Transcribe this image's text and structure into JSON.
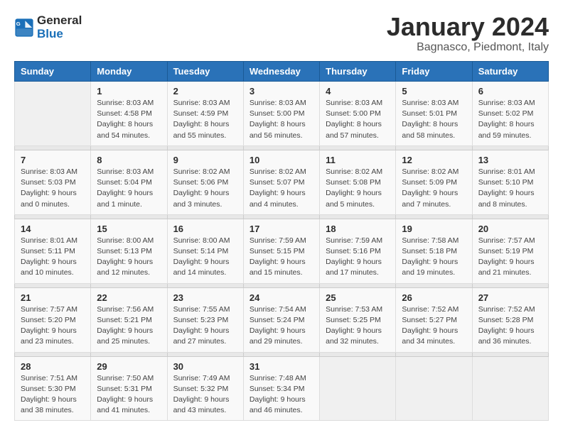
{
  "logo": {
    "line1": "General",
    "line2": "Blue"
  },
  "title": "January 2024",
  "location": "Bagnasco, Piedmont, Italy",
  "days_of_week": [
    "Sunday",
    "Monday",
    "Tuesday",
    "Wednesday",
    "Thursday",
    "Friday",
    "Saturday"
  ],
  "weeks": [
    [
      {
        "day": "",
        "info": ""
      },
      {
        "day": "1",
        "info": "Sunrise: 8:03 AM\nSunset: 4:58 PM\nDaylight: 8 hours\nand 54 minutes."
      },
      {
        "day": "2",
        "info": "Sunrise: 8:03 AM\nSunset: 4:59 PM\nDaylight: 8 hours\nand 55 minutes."
      },
      {
        "day": "3",
        "info": "Sunrise: 8:03 AM\nSunset: 5:00 PM\nDaylight: 8 hours\nand 56 minutes."
      },
      {
        "day": "4",
        "info": "Sunrise: 8:03 AM\nSunset: 5:00 PM\nDaylight: 8 hours\nand 57 minutes."
      },
      {
        "day": "5",
        "info": "Sunrise: 8:03 AM\nSunset: 5:01 PM\nDaylight: 8 hours\nand 58 minutes."
      },
      {
        "day": "6",
        "info": "Sunrise: 8:03 AM\nSunset: 5:02 PM\nDaylight: 8 hours\nand 59 minutes."
      }
    ],
    [
      {
        "day": "7",
        "info": "Sunrise: 8:03 AM\nSunset: 5:03 PM\nDaylight: 9 hours\nand 0 minutes."
      },
      {
        "day": "8",
        "info": "Sunrise: 8:03 AM\nSunset: 5:04 PM\nDaylight: 9 hours\nand 1 minute."
      },
      {
        "day": "9",
        "info": "Sunrise: 8:02 AM\nSunset: 5:06 PM\nDaylight: 9 hours\nand 3 minutes."
      },
      {
        "day": "10",
        "info": "Sunrise: 8:02 AM\nSunset: 5:07 PM\nDaylight: 9 hours\nand 4 minutes."
      },
      {
        "day": "11",
        "info": "Sunrise: 8:02 AM\nSunset: 5:08 PM\nDaylight: 9 hours\nand 5 minutes."
      },
      {
        "day": "12",
        "info": "Sunrise: 8:02 AM\nSunset: 5:09 PM\nDaylight: 9 hours\nand 7 minutes."
      },
      {
        "day": "13",
        "info": "Sunrise: 8:01 AM\nSunset: 5:10 PM\nDaylight: 9 hours\nand 8 minutes."
      }
    ],
    [
      {
        "day": "14",
        "info": "Sunrise: 8:01 AM\nSunset: 5:11 PM\nDaylight: 9 hours\nand 10 minutes."
      },
      {
        "day": "15",
        "info": "Sunrise: 8:00 AM\nSunset: 5:13 PM\nDaylight: 9 hours\nand 12 minutes."
      },
      {
        "day": "16",
        "info": "Sunrise: 8:00 AM\nSunset: 5:14 PM\nDaylight: 9 hours\nand 14 minutes."
      },
      {
        "day": "17",
        "info": "Sunrise: 7:59 AM\nSunset: 5:15 PM\nDaylight: 9 hours\nand 15 minutes."
      },
      {
        "day": "18",
        "info": "Sunrise: 7:59 AM\nSunset: 5:16 PM\nDaylight: 9 hours\nand 17 minutes."
      },
      {
        "day": "19",
        "info": "Sunrise: 7:58 AM\nSunset: 5:18 PM\nDaylight: 9 hours\nand 19 minutes."
      },
      {
        "day": "20",
        "info": "Sunrise: 7:57 AM\nSunset: 5:19 PM\nDaylight: 9 hours\nand 21 minutes."
      }
    ],
    [
      {
        "day": "21",
        "info": "Sunrise: 7:57 AM\nSunset: 5:20 PM\nDaylight: 9 hours\nand 23 minutes."
      },
      {
        "day": "22",
        "info": "Sunrise: 7:56 AM\nSunset: 5:21 PM\nDaylight: 9 hours\nand 25 minutes."
      },
      {
        "day": "23",
        "info": "Sunrise: 7:55 AM\nSunset: 5:23 PM\nDaylight: 9 hours\nand 27 minutes."
      },
      {
        "day": "24",
        "info": "Sunrise: 7:54 AM\nSunset: 5:24 PM\nDaylight: 9 hours\nand 29 minutes."
      },
      {
        "day": "25",
        "info": "Sunrise: 7:53 AM\nSunset: 5:25 PM\nDaylight: 9 hours\nand 32 minutes."
      },
      {
        "day": "26",
        "info": "Sunrise: 7:52 AM\nSunset: 5:27 PM\nDaylight: 9 hours\nand 34 minutes."
      },
      {
        "day": "27",
        "info": "Sunrise: 7:52 AM\nSunset: 5:28 PM\nDaylight: 9 hours\nand 36 minutes."
      }
    ],
    [
      {
        "day": "28",
        "info": "Sunrise: 7:51 AM\nSunset: 5:30 PM\nDaylight: 9 hours\nand 38 minutes."
      },
      {
        "day": "29",
        "info": "Sunrise: 7:50 AM\nSunset: 5:31 PM\nDaylight: 9 hours\nand 41 minutes."
      },
      {
        "day": "30",
        "info": "Sunrise: 7:49 AM\nSunset: 5:32 PM\nDaylight: 9 hours\nand 43 minutes."
      },
      {
        "day": "31",
        "info": "Sunrise: 7:48 AM\nSunset: 5:34 PM\nDaylight: 9 hours\nand 46 minutes."
      },
      {
        "day": "",
        "info": ""
      },
      {
        "day": "",
        "info": ""
      },
      {
        "day": "",
        "info": ""
      }
    ]
  ]
}
